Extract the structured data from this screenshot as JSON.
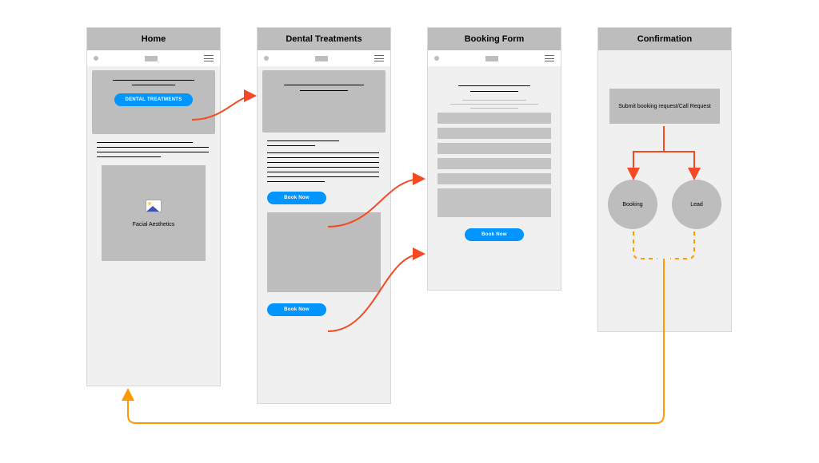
{
  "diagram": {
    "purpose": "User-flow wireframe for a dental clinic website",
    "colors": {
      "arrow_primary": "#F54923",
      "arrow_return": "#FF9900",
      "button": "#0095FF",
      "grey": "#BDBDBD"
    }
  },
  "screens": {
    "home": {
      "title": "Home",
      "cta_button": "DENTAL TREATMENTS",
      "card_label": "Facial Aesthetics"
    },
    "treatments": {
      "title": "Dental Treatments",
      "book_button_1": "Book Now",
      "book_button_2": "Book Now"
    },
    "booking": {
      "title": "Booking Form",
      "submit_button": "Book Now"
    },
    "confirmation": {
      "title": "Confirmation",
      "action_label": "Submit booking request/Call Request",
      "node_booking": "Booking",
      "node_lead": "Lead"
    }
  }
}
